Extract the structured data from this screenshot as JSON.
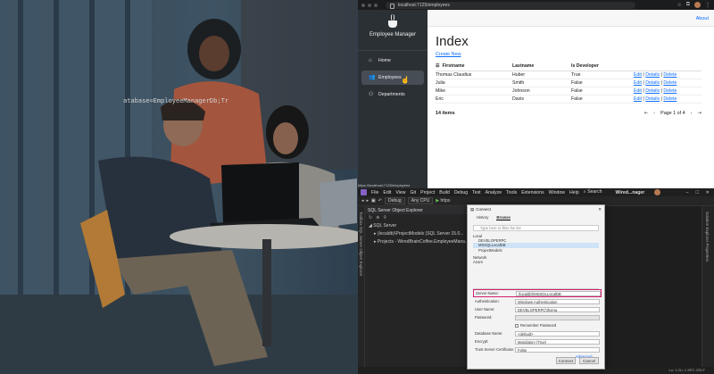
{
  "browser": {
    "url": "localhost:7125/employees",
    "status_url": "https://localhost:7125/employees",
    "app": {
      "brand": "Employee Manager",
      "nav": [
        {
          "label": "Home",
          "icon": "home-icon"
        },
        {
          "label": "Employees",
          "icon": "people-icon"
        },
        {
          "label": "Departments",
          "icon": "departments-icon"
        }
      ],
      "about": "About",
      "heading": "Index",
      "create_link": "Create New",
      "columns": [
        "Firstname",
        "Lastname",
        "Is Developer"
      ],
      "rows": [
        {
          "first": "Thomas Claudius",
          "last": "Huber",
          "dev": "True"
        },
        {
          "first": "Julia",
          "last": "Smith",
          "dev": "False"
        },
        {
          "first": "Mike",
          "last": "Johnson",
          "dev": "False"
        },
        {
          "first": "Eric",
          "last": "Davis",
          "dev": "False"
        }
      ],
      "actions": {
        "edit": "Edit",
        "details": "Details",
        "delete": "Delete",
        "sep": "|"
      },
      "items_count": "14 items",
      "page_label": "Page 1 of 4"
    }
  },
  "vs": {
    "menu": [
      "File",
      "Edit",
      "View",
      "Git",
      "Project",
      "Build",
      "Debug",
      "Test",
      "Analyze",
      "Tools",
      "Extensions",
      "Window",
      "Help"
    ],
    "search": "Search",
    "window_name": "Wired...nager",
    "toolbar": {
      "config": "Debug",
      "platform": "Any CPU",
      "run": "https"
    },
    "left_rail": "Toolbox SQL Server Object Explorer",
    "right_rail": "Solution Explorer Properties",
    "sso_title": "SQL Server Object Explorer",
    "sso_nodes": [
      "SQL Server",
      "(localdb)\\ProjectModels (SQL Server 15.0...",
      "Projects - WiredBrainCoffee.EmployeeMana..."
    ],
    "code_text": "atabase=EmployeeManagerDb;Tr",
    "status_right": "Ln: 1 Ch: 1 SPC CRLF"
  },
  "dialog": {
    "title": "Connect",
    "tabs": [
      "History",
      "Browse"
    ],
    "search_placeholder": "Type here to filter the list",
    "tree": [
      "Local",
      "DEVELOPERPC",
      "MSSQLLocalDB",
      "ProjectModels",
      "Network",
      "Azure"
    ],
    "fields": [
      {
        "label": "Server Name:",
        "value": "(localdb)\\MSSQLLocalDB"
      },
      {
        "label": "Authentication:",
        "value": "Windows Authentication"
      },
      {
        "label": "User Name:",
        "value": "DEVELOPERPC\\thoma"
      },
      {
        "label": "Password:",
        "value": ""
      },
      {
        "label": "",
        "value": "Remember Password"
      },
      {
        "label": "Database Name:",
        "value": "<default>"
      },
      {
        "label": "Encrypt:",
        "value": "Mandatory (True)"
      },
      {
        "label": "Trust Server Certificate:",
        "value": "False"
      }
    ],
    "advanced": "Advanced...",
    "connect": "Connect",
    "cancel": "Cancel"
  }
}
